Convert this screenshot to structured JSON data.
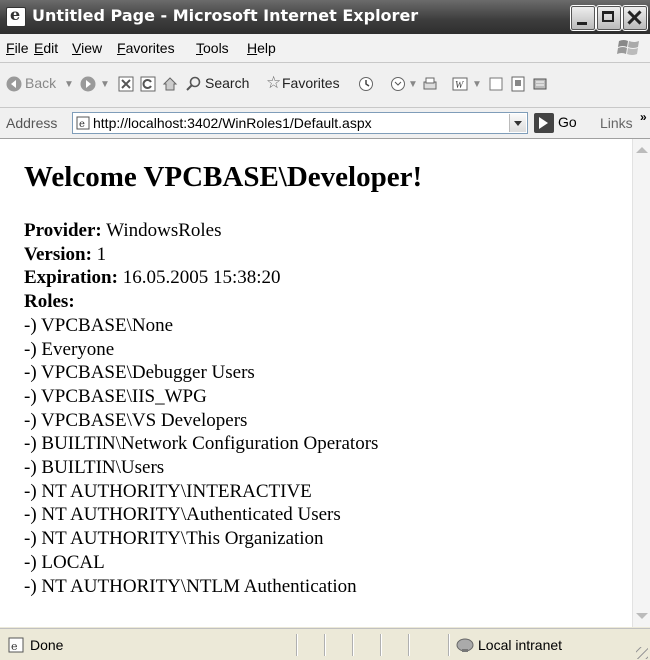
{
  "window": {
    "title": "Untitled Page - Microsoft Internet Explorer"
  },
  "menu": {
    "items": [
      "File",
      "Edit",
      "View",
      "Favorites",
      "Tools",
      "Help"
    ]
  },
  "toolbar": {
    "back_label": "Back",
    "search_label": "Search",
    "favorites_label": "Favorites"
  },
  "address": {
    "label": "Address",
    "url": "http://localhost:3402/WinRoles1/Default.aspx",
    "go_label": "Go",
    "links_label": "Links",
    "chevron": "»"
  },
  "page": {
    "heading": "Welcome VPCBASE\\Developer!",
    "provider_label": "Provider:",
    "provider_value": " WindowsRoles",
    "version_label": "Version:",
    "version_value": " 1",
    "expiration_label": "Expiration:",
    "expiration_value": " 16.05.2005 15:38:20",
    "roles_label": "Roles:",
    "roles": [
      "-) VPCBASE\\None",
      "-) Everyone",
      "-) VPCBASE\\Debugger Users",
      "-) VPCBASE\\IIS_WPG",
      "-) VPCBASE\\VS Developers",
      "-) BUILTIN\\Network Configuration Operators",
      "-) BUILTIN\\Users",
      "-) NT AUTHORITY\\INTERACTIVE",
      "-) NT AUTHORITY\\Authenticated Users",
      "-) NT AUTHORITY\\This Organization",
      "-) LOCAL",
      "-) NT AUTHORITY\\NTLM Authentication"
    ]
  },
  "status": {
    "text": "Done",
    "zone": "Local intranet"
  },
  "icons": {
    "app": "ie-icon",
    "back": "back-arrow-icon",
    "forward": "forward-arrow-icon",
    "stop": "stop-icon",
    "refresh": "refresh-icon",
    "home": "home-icon",
    "search": "search-icon",
    "favorites": "star-icon",
    "history": "history-icon",
    "mail": "mail-icon",
    "print": "print-icon",
    "edit": "edit-icon",
    "discuss": "discuss-icon",
    "messenger": "messenger-icon"
  }
}
